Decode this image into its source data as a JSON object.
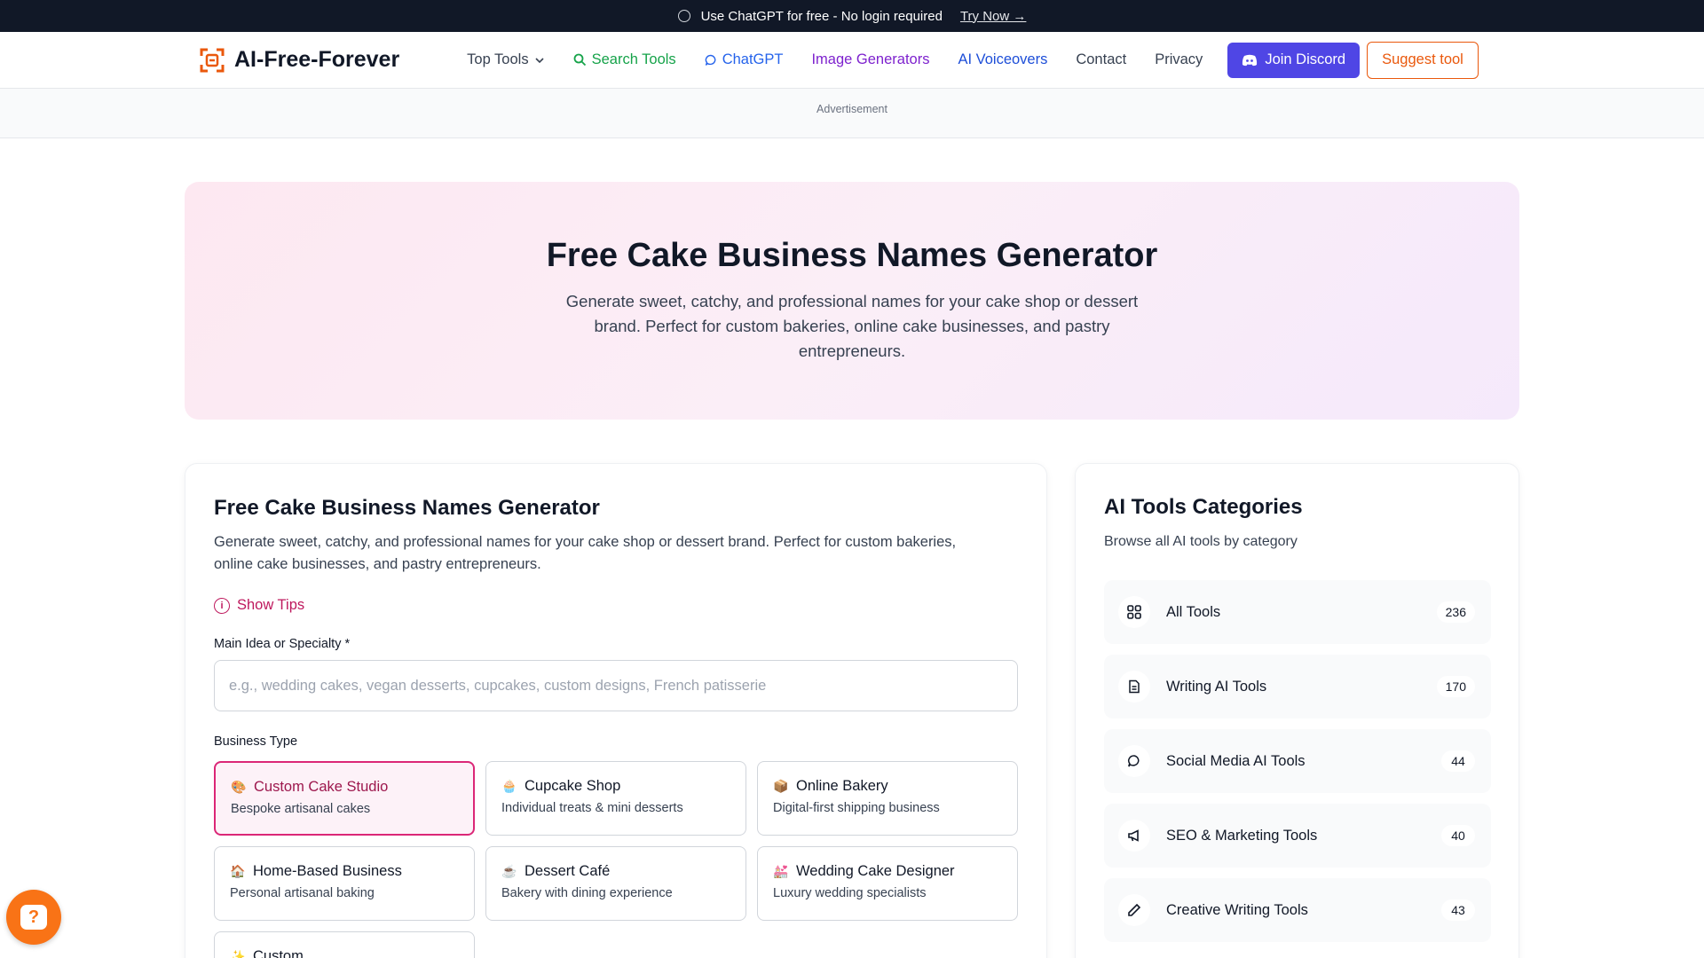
{
  "announcement": {
    "text": "Use ChatGPT for free - No login required",
    "link": "Try Now →"
  },
  "nav": {
    "logo": "AI-Free-Forever",
    "items": [
      {
        "label": "Top Tools",
        "color": "#374151"
      },
      {
        "label": "Search Tools",
        "color": "#16a34a"
      },
      {
        "label": "ChatGPT",
        "color": "#2563eb"
      },
      {
        "label": "Image Generators",
        "color": "#7e22ce"
      },
      {
        "label": "AI Voiceovers",
        "color": "#1d4ed8"
      },
      {
        "label": "Contact",
        "color": "#374151"
      },
      {
        "label": "Privacy",
        "color": "#374151"
      }
    ],
    "discord_label": "Join Discord",
    "suggest_label": "Suggest tool"
  },
  "ad": {
    "label": "Advertisement"
  },
  "hero": {
    "title": "Free Cake Business Names Generator",
    "subtitle": "Generate sweet, catchy, and professional names for your cake shop or dessert brand. Perfect for custom bakeries, online cake businesses, and pastry entrepreneurs."
  },
  "generator": {
    "title": "Free Cake Business Names Generator",
    "description": "Generate sweet, catchy, and professional names for your cake shop or dessert brand. Perfect for custom bakeries, online cake businesses, and pastry entrepreneurs.",
    "tips_label": "Show Tips",
    "main_idea_label": "Main Idea or Specialty *",
    "main_idea_placeholder": "e.g., wedding cakes, vegan desserts, cupcakes, custom designs, French patisserie",
    "business_type_label": "Business Type",
    "options": [
      {
        "title": "Custom Cake Studio",
        "sub": "Bespoke artisanal cakes",
        "icon": "🎨",
        "selected": true
      },
      {
        "title": "Cupcake Shop",
        "sub": "Individual treats & mini desserts",
        "icon": "🧁",
        "selected": false
      },
      {
        "title": "Online Bakery",
        "sub": "Digital-first shipping business",
        "icon": "📦",
        "selected": false
      },
      {
        "title": "Home-Based Business",
        "sub": "Personal artisanal baking",
        "icon": "🏠",
        "selected": false
      },
      {
        "title": "Dessert Café",
        "sub": "Bakery with dining experience",
        "icon": "☕",
        "selected": false
      },
      {
        "title": "Wedding Cake Designer",
        "sub": "Luxury wedding specialists",
        "icon": "💒",
        "selected": false
      },
      {
        "title": "Custom",
        "sub": "",
        "icon": "✨",
        "selected": false
      }
    ]
  },
  "categories": {
    "title": "AI Tools Categories",
    "subtitle": "Browse all AI tools by category",
    "items": [
      {
        "name": "All Tools",
        "count": "236",
        "icon": "grid-icon"
      },
      {
        "name": "Writing AI Tools",
        "count": "170",
        "icon": "document-icon"
      },
      {
        "name": "Social Media AI Tools",
        "count": "44",
        "icon": "chat-bubble-icon"
      },
      {
        "name": "SEO & Marketing Tools",
        "count": "40",
        "icon": "megaphone-icon"
      },
      {
        "name": "Creative Writing Tools",
        "count": "43",
        "icon": "pencil-icon"
      }
    ]
  }
}
